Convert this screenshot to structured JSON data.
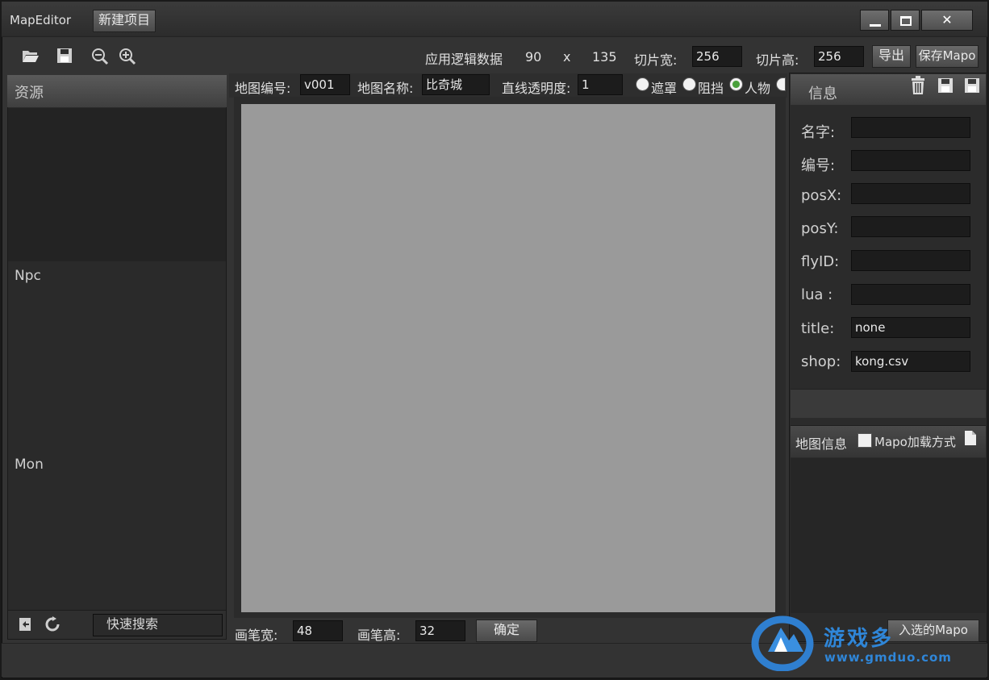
{
  "window": {
    "title": "MapEditor",
    "new_project_label": "新建项目",
    "minimize_icon": "minimize-icon",
    "maximize_icon": "maximize-icon",
    "close_label": "✕"
  },
  "toolbar": {
    "open_icon": "folder-open-icon",
    "save_icon": "save-icon",
    "zoom_out_icon": "zoom-out-icon",
    "zoom_in_icon": "zoom-in-icon",
    "logic_label": "应用逻辑数据",
    "logic_w": "90",
    "logic_x": "x",
    "logic_h": "135",
    "slice_w_label": "切片宽:",
    "slice_w": "256",
    "slice_h_label": "切片高:",
    "slice_h": "256",
    "export_label": "导出",
    "save_mapo_label": "保存Mapo"
  },
  "resources": {
    "header": "资源",
    "section_npc": "Npc",
    "section_mon": "Mon",
    "search_label": "快速搜索"
  },
  "map_bar": {
    "id_label": "地图编号:",
    "id_value": "v001",
    "name_label": "地图名称:",
    "name_value": "比奇城",
    "alpha_label": "直线透明度:",
    "alpha_value": "1",
    "radios": [
      {
        "label": "遮罩",
        "checked": false
      },
      {
        "label": "阻挡",
        "checked": false
      },
      {
        "label": "人物",
        "checked": true
      }
    ]
  },
  "brush": {
    "w_label": "画笔宽:",
    "w_value": "48",
    "h_label": "画笔高:",
    "h_value": "32",
    "confirm_label": "确定"
  },
  "info": {
    "header": "信息",
    "fields": [
      {
        "label": "名字:",
        "value": ""
      },
      {
        "label": "编号:",
        "value": ""
      },
      {
        "label": "posX:",
        "value": ""
      },
      {
        "label": "posY:",
        "value": ""
      },
      {
        "label": "flyID:",
        "value": ""
      },
      {
        "label": "lua :",
        "value": ""
      },
      {
        "label": "title:",
        "value": "none"
      },
      {
        "label": "shop:",
        "value": "kong.csv"
      }
    ]
  },
  "map_info": {
    "header": "地图信息",
    "mapo_load_label": "Mapo加载方式",
    "import_label": "入选的Mapo"
  },
  "watermark": {
    "name": "游戏多",
    "url": "www.gmduo.com"
  }
}
